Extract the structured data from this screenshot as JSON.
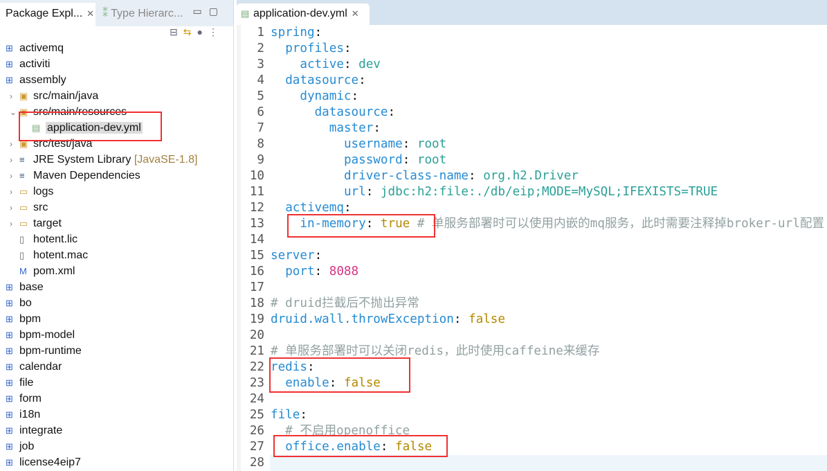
{
  "explorer": {
    "tab1": "Package Expl...",
    "tab2": "Type Hierarc...",
    "items": [
      {
        "label": "activemq",
        "icon": "maven-project-icon",
        "level": 0
      },
      {
        "label": "activiti",
        "icon": "maven-project-icon",
        "level": 0
      },
      {
        "label": "assembly",
        "icon": "maven-project-icon",
        "level": 0
      },
      {
        "label": "src/main/java",
        "icon": "source-folder-icon",
        "level": 1,
        "arrow": "›"
      },
      {
        "label": "src/main/resources",
        "icon": "source-folder-icon",
        "level": 1,
        "arrow": "⌄"
      },
      {
        "label": "application-dev.yml",
        "icon": "yaml-file-icon",
        "level": 2,
        "selected": true
      },
      {
        "label": "src/test/java",
        "icon": "source-folder-icon",
        "level": 1,
        "arrow": "›"
      },
      {
        "label": "JRE System Library",
        "decoration": "[JavaSE-1.8]",
        "icon": "library-icon",
        "level": 1,
        "arrow": "›"
      },
      {
        "label": "Maven Dependencies",
        "icon": "library-icon",
        "level": 1,
        "arrow": "›"
      },
      {
        "label": "logs",
        "icon": "folder-icon",
        "level": 1,
        "arrow": "›"
      },
      {
        "label": "src",
        "icon": "folder-icon",
        "level": 1,
        "arrow": "›"
      },
      {
        "label": "target",
        "icon": "folder-icon",
        "level": 1,
        "arrow": "›"
      },
      {
        "label": "hotent.lic",
        "icon": "file-icon",
        "level": 1
      },
      {
        "label": "hotent.mac",
        "icon": "file-icon",
        "level": 1
      },
      {
        "label": "pom.xml",
        "icon": "maven-pom-icon",
        "level": 1
      },
      {
        "label": "base",
        "icon": "maven-project-icon",
        "level": 0
      },
      {
        "label": "bo",
        "icon": "maven-project-icon",
        "level": 0
      },
      {
        "label": "bpm",
        "icon": "maven-project-icon",
        "level": 0
      },
      {
        "label": "bpm-model",
        "icon": "maven-project-icon",
        "level": 0
      },
      {
        "label": "bpm-runtime",
        "icon": "maven-project-icon",
        "level": 0
      },
      {
        "label": "calendar",
        "icon": "maven-project-icon",
        "level": 0
      },
      {
        "label": "file",
        "icon": "maven-project-icon",
        "level": 0
      },
      {
        "label": "form",
        "icon": "maven-project-icon",
        "level": 0
      },
      {
        "label": "i18n",
        "icon": "maven-project-icon",
        "level": 0
      },
      {
        "label": "integrate",
        "icon": "maven-project-icon",
        "level": 0
      },
      {
        "label": "job",
        "icon": "maven-project-icon",
        "level": 0
      },
      {
        "label": "license4eip7",
        "icon": "maven-project-icon",
        "level": 0
      }
    ]
  },
  "editor": {
    "tab": "application-dev.yml",
    "lines": [
      [
        [
          "k",
          "spring"
        ],
        [
          "p",
          ":"
        ]
      ],
      [
        [
          "p",
          "  "
        ],
        [
          "k",
          "profiles"
        ],
        [
          "p",
          ":"
        ]
      ],
      [
        [
          "p",
          "    "
        ],
        [
          "k",
          "active"
        ],
        [
          "p",
          ": "
        ],
        [
          "s",
          "dev"
        ]
      ],
      [
        [
          "p",
          "  "
        ],
        [
          "k",
          "datasource"
        ],
        [
          "p",
          ":"
        ]
      ],
      [
        [
          "p",
          "    "
        ],
        [
          "k",
          "dynamic"
        ],
        [
          "p",
          ":"
        ]
      ],
      [
        [
          "p",
          "      "
        ],
        [
          "k",
          "datasource"
        ],
        [
          "p",
          ":"
        ]
      ],
      [
        [
          "p",
          "        "
        ],
        [
          "k",
          "master"
        ],
        [
          "p",
          ":"
        ]
      ],
      [
        [
          "p",
          "          "
        ],
        [
          "k",
          "username"
        ],
        [
          "p",
          ": "
        ],
        [
          "s",
          "root"
        ]
      ],
      [
        [
          "p",
          "          "
        ],
        [
          "k",
          "password"
        ],
        [
          "p",
          ": "
        ],
        [
          "s",
          "root"
        ]
      ],
      [
        [
          "p",
          "          "
        ],
        [
          "k",
          "driver-class-name"
        ],
        [
          "p",
          ": "
        ],
        [
          "s",
          "org.h2.Driver"
        ]
      ],
      [
        [
          "p",
          "          "
        ],
        [
          "k",
          "url"
        ],
        [
          "p",
          ": "
        ],
        [
          "s",
          "jdbc:h2:file:./db/eip;MODE=MySQL;IFEXISTS=TRUE"
        ]
      ],
      [
        [
          "p",
          "  "
        ],
        [
          "k",
          "activemq"
        ],
        [
          "p",
          ":"
        ]
      ],
      [
        [
          "p",
          "    "
        ],
        [
          "k",
          "in-memory"
        ],
        [
          "p",
          ": "
        ],
        [
          "b",
          "true"
        ],
        [
          "c",
          " # 单服务部署时可以使用内嵌的mq服务，此时需要注释掉broker-url配置"
        ]
      ],
      [],
      [
        [
          "k",
          "server"
        ],
        [
          "p",
          ":"
        ]
      ],
      [
        [
          "p",
          "  "
        ],
        [
          "k",
          "port"
        ],
        [
          "p",
          ": "
        ],
        [
          "n",
          "8088"
        ]
      ],
      [],
      [
        [
          "c",
          "# druid拦截后不抛出异常"
        ]
      ],
      [
        [
          "k",
          "druid.wall.throwException"
        ],
        [
          "p",
          ": "
        ],
        [
          "b",
          "false"
        ]
      ],
      [],
      [
        [
          "c",
          "# 单服务部署时可以关闭redis，此时使用caffeine来缓存"
        ]
      ],
      [
        [
          "k",
          "redis"
        ],
        [
          "p",
          ":"
        ]
      ],
      [
        [
          "p",
          "  "
        ],
        [
          "k",
          "enable"
        ],
        [
          "p",
          ": "
        ],
        [
          "b",
          "false"
        ]
      ],
      [],
      [
        [
          "k",
          "file"
        ],
        [
          "p",
          ":"
        ]
      ],
      [
        [
          "c",
          "  # 不启用openoffice"
        ]
      ],
      [
        [
          "p",
          "  "
        ],
        [
          "k",
          "office.enable"
        ],
        [
          "p",
          ": "
        ],
        [
          "b",
          "false"
        ]
      ],
      []
    ]
  },
  "colors": {
    "key": "#268bd2",
    "string": "#2aa198",
    "boolean": "#b58900",
    "number": "#d33682",
    "comment": "#93a1a1",
    "highlight": "#f03030"
  }
}
